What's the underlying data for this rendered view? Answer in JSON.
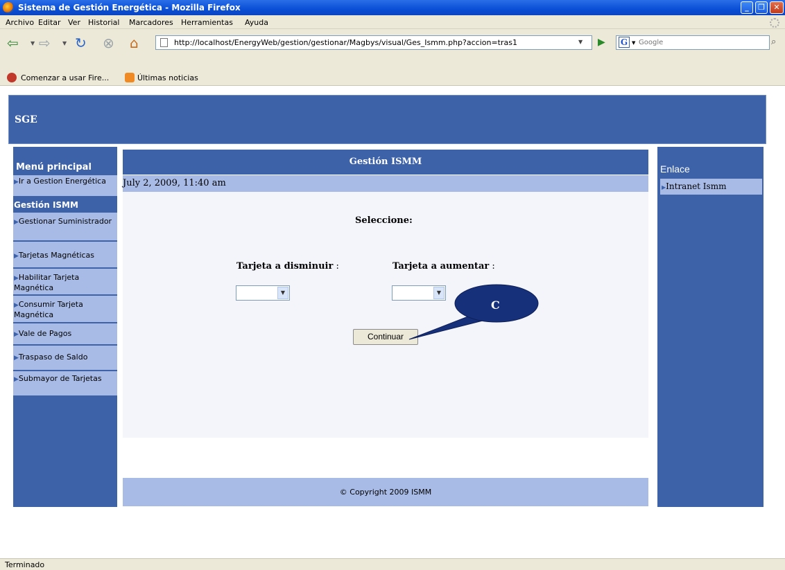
{
  "window": {
    "title": "Sistema de Gestión Energética - Mozilla Firefox",
    "minimize": "_",
    "restore": "❐",
    "close": "✕"
  },
  "menu": [
    "Archivo",
    "Editar",
    "Ver",
    "Historial",
    "Marcadores",
    "Herramientas",
    "Ayuda"
  ],
  "toolbar": {
    "url": "http://localhost/EnergyWeb/gestion/gestionar/Magbys/visual/Ges_Ismm.php?accion=tras1",
    "search_placeholder": "Google",
    "search_engine_letter": "G"
  },
  "bookmarks": [
    "Comenzar a usar Fire...",
    "Últimas noticias"
  ],
  "page": {
    "logo": "SGE",
    "left_menu": {
      "heading": "Menú principal",
      "top_item": "Ir a Gestion Energética",
      "group": "Gestión ISMM",
      "items": [
        "Gestionar Suministrador",
        "Tarjetas Magnéticas",
        "Habilitar Tarjeta Magnética",
        "Consumir Tarjeta Magnética",
        "Vale de Pagos",
        "Traspaso de Saldo",
        "Submayor de Tarjetas"
      ]
    },
    "right_menu": {
      "heading": "Enlace",
      "item": "Intranet Ismm"
    },
    "center": {
      "heading": "Gestión ISMM",
      "date": "July 2, 2009, 11:40 am",
      "prompt": "Seleccione:",
      "label_decrease_bold": "Tarjeta a disminuir",
      "label_increase_bold": "Tarjeta a aumentar",
      "label_suffix": " :",
      "select_decrease_value": "",
      "select_increase_value": "",
      "continue_button": "Continuar"
    },
    "footer": "© Copyright 2009 ISMM",
    "annotation_label": "C"
  },
  "status": "Terminado",
  "colors": {
    "brand_blue": "#3d62a8",
    "light_blue": "#a8bbe6",
    "content_bg": "#f4f5fb"
  }
}
